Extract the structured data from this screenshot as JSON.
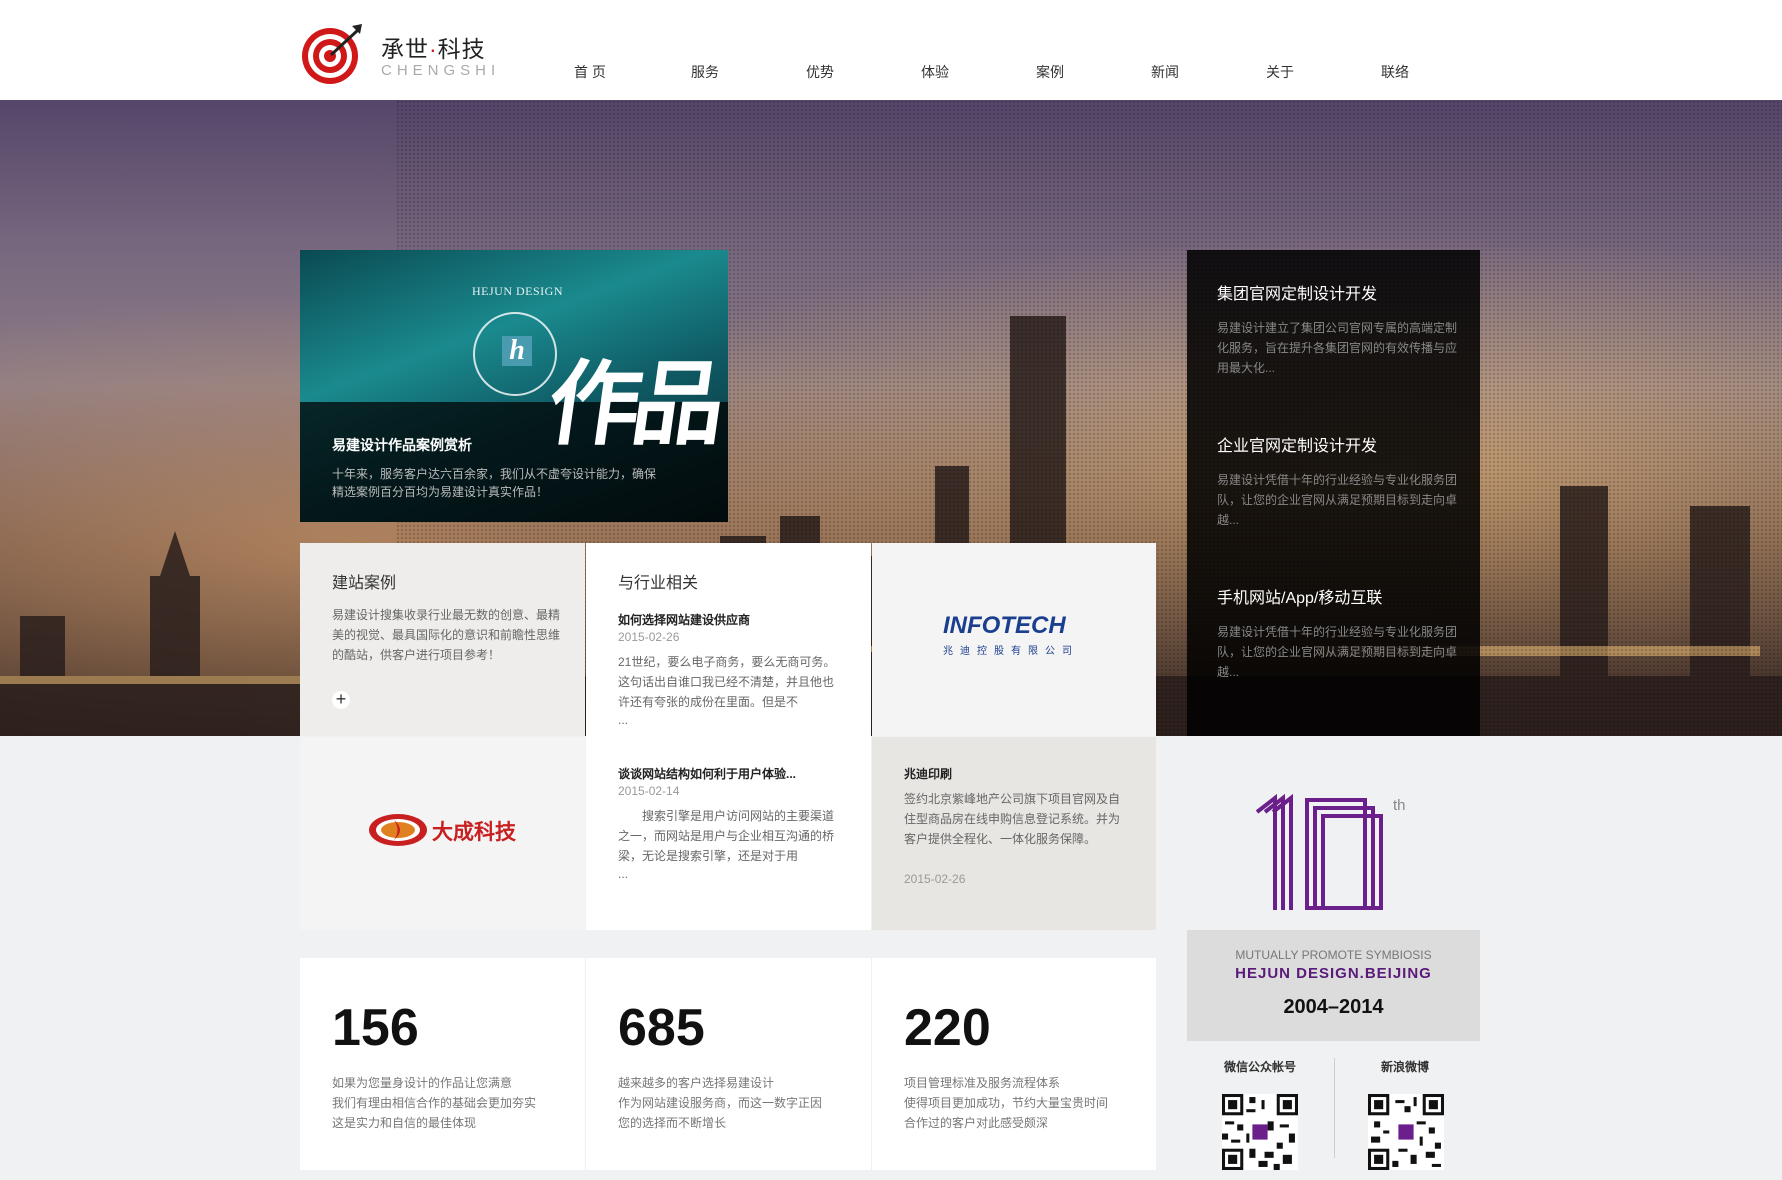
{
  "brand": {
    "name_cn_a": "承世",
    "dot": "·",
    "name_cn_b": "科技",
    "name_en": "CHENGSHI"
  },
  "nav": [
    "首 页",
    "服务",
    "优势",
    "体验",
    "案例",
    "新闻",
    "关于",
    "联络"
  ],
  "feature": {
    "brand_text": "HEJUN DESIGN",
    "calligraphy": "作品",
    "title": "易建设计作品案例赏析",
    "desc": "十年来，服务客户达六百余家，我们从不虚夸设计能力，确保精选案例百分百均为易建设计真实作品！"
  },
  "services": [
    {
      "title": "集团官网定制设计开发",
      "desc": "易建设计建立了集团公司官网专属的高端定制化服务，旨在提升各集团官网的有效传播与应用最大化..."
    },
    {
      "title": "企业官网定制设计开发",
      "desc": "易建设计凭借十年的行业经验与专业化服务团队，让您的企业官网从满足预期目标到走向卓越..."
    },
    {
      "title": "手机网站/App/移动互联",
      "desc": "易建设计凭借十年的行业经验与专业化服务团队，让您的企业官网从满足预期目标到走向卓越..."
    }
  ],
  "cases": {
    "title": "建站案例",
    "desc": "易建设计搜集收录行业最无数的创意、最精美的视觉、最具国际化的意识和前瞻性思维的酷站，供客户进行项目参考！",
    "plus": "+"
  },
  "industry": {
    "title": "与行业相关",
    "news": [
      {
        "title": "如何选择网站建设供应商",
        "date": "2015-02-26",
        "desc": "21世纪，要么电子商务，要么无商可务。这句话出自谁口我已经不清楚，并且他也许还有夸张的成份在里面。但是不",
        "more": "..."
      },
      {
        "title": "谈谈网站结构如何利于用户体验...",
        "date": "2015-02-14",
        "desc": "　　搜索引擎是用户访问网站的主要渠道之一，而网站是用户与企业相互沟通的桥梁，无论是搜索引擎，还是对于用",
        "more": "..."
      }
    ]
  },
  "infotech": {
    "main": "INFOTECH",
    "sub": "兆迪控股有限公司"
  },
  "zhaodi": {
    "title": "兆迪印刷",
    "desc": "签约北京紫峰地产公司旗下项目官网及自住型商品房在线申购信息登记系统。并为客户提供全程化、一体化服务保障。",
    "date": "2015-02-26"
  },
  "dacheng": {
    "name": "大成科技"
  },
  "stats": [
    {
      "num": "156",
      "lines": [
        "如果为您量身设计的作品让您满意",
        "我们有理由相信合作的基础会更加夯实",
        "这是实力和自信的最佳体现"
      ]
    },
    {
      "num": "685",
      "lines": [
        "越来越多的客户选择易建设计",
        "作为网站建设服务商，而这一数字正因",
        "您的选择而不断增长"
      ]
    },
    {
      "num": "220",
      "lines": [
        "项目管理标准及服务流程体系",
        "使得项目更加成功，节约大量宝贵时间",
        "合作过的客户对此感受颇深"
      ]
    }
  ],
  "anniversary": {
    "number": "10",
    "suffix": "th",
    "line1": "MUTUALLY PROMOTE SYMBIOSIS",
    "line2": "HEJUN DESIGN.BEIJING",
    "years": "2004–2014",
    "purple": "#6a1f8a"
  },
  "social": {
    "wechat": "微信公众帐号",
    "weibo": "新浪微博"
  },
  "colors": {
    "accent_red": "#d01818",
    "infotech_blue": "#1b3f8f"
  }
}
